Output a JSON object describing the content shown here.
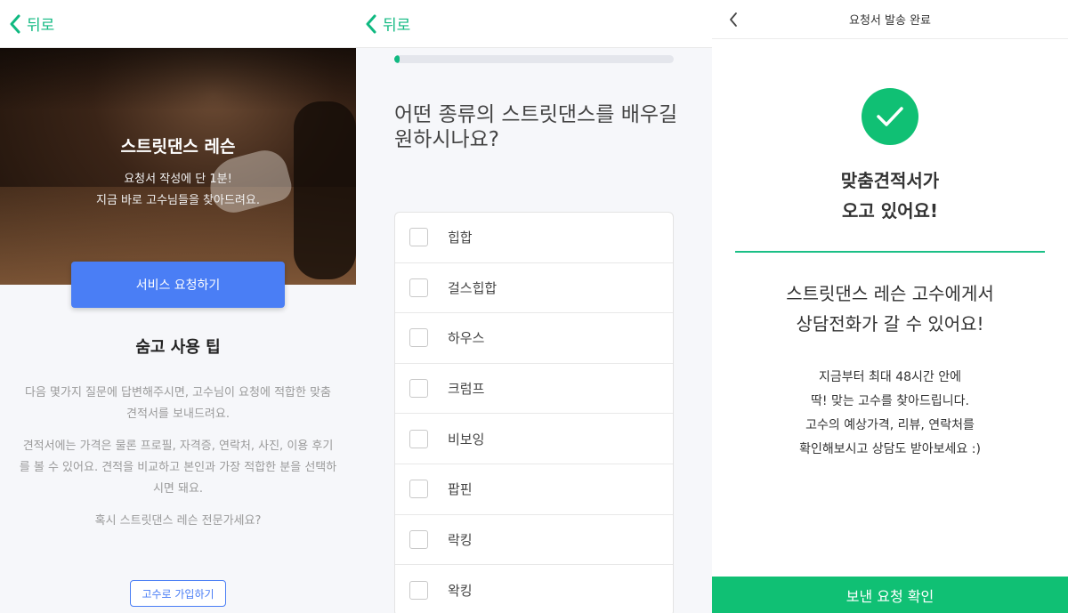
{
  "screen1": {
    "back_label": "뒤로",
    "hero_title": "스트릿댄스 레슨",
    "hero_sub1": "요청서 작성에 단 1분!",
    "hero_sub2": "지금 바로 고수님들을 찾아드려요.",
    "cta_label": "서비스 요청하기",
    "tip_title": "숨고 사용 팁",
    "tip_p1": "다음 몇가지 질문에 답변해주시면, 고수님이 요청에 적합한 맞춤 견적서를 보내드려요.",
    "tip_p2": "견적서에는 가격은 물론 프로필, 자격증, 연락처, 사진, 이용 후기를 볼 수 있어요. 견적을 비교하고 본인과 가장 적합한 분을 선택하시면 돼요.",
    "tip_p3": "혹시 스트릿댄스 레슨 전문가세요?",
    "join_label": "고수로 가입하기"
  },
  "screen2": {
    "back_label": "뒤로",
    "progress": 0.02,
    "question": "어떤 종류의 스트릿댄스를 배우길 원하시나요?",
    "options": [
      "힙합",
      "걸스힙합",
      "하우스",
      "크럼프",
      "비보잉",
      "팝핀",
      "락킹",
      "왁킹"
    ]
  },
  "screen3": {
    "title": "요청서 발송 완료",
    "heading": "맞춤견적서가 오고 있어요!",
    "subheading": "스트릿댄스 레슨 고수에게서 상담전화가 갈 수 있어요!",
    "para_lines": [
      "지금부터 최대 48시간 안에",
      "딱! 맞는 고수를 찾아드립니다.",
      "고수의 예상가격, 리뷰, 연락처를",
      "확인해보시고 상담도 받아보세요 :)"
    ],
    "bottom_label": "보낸 요청 확인"
  },
  "colors": {
    "accent_green": "#10c074",
    "cta_blue": "#4a7ef5"
  }
}
